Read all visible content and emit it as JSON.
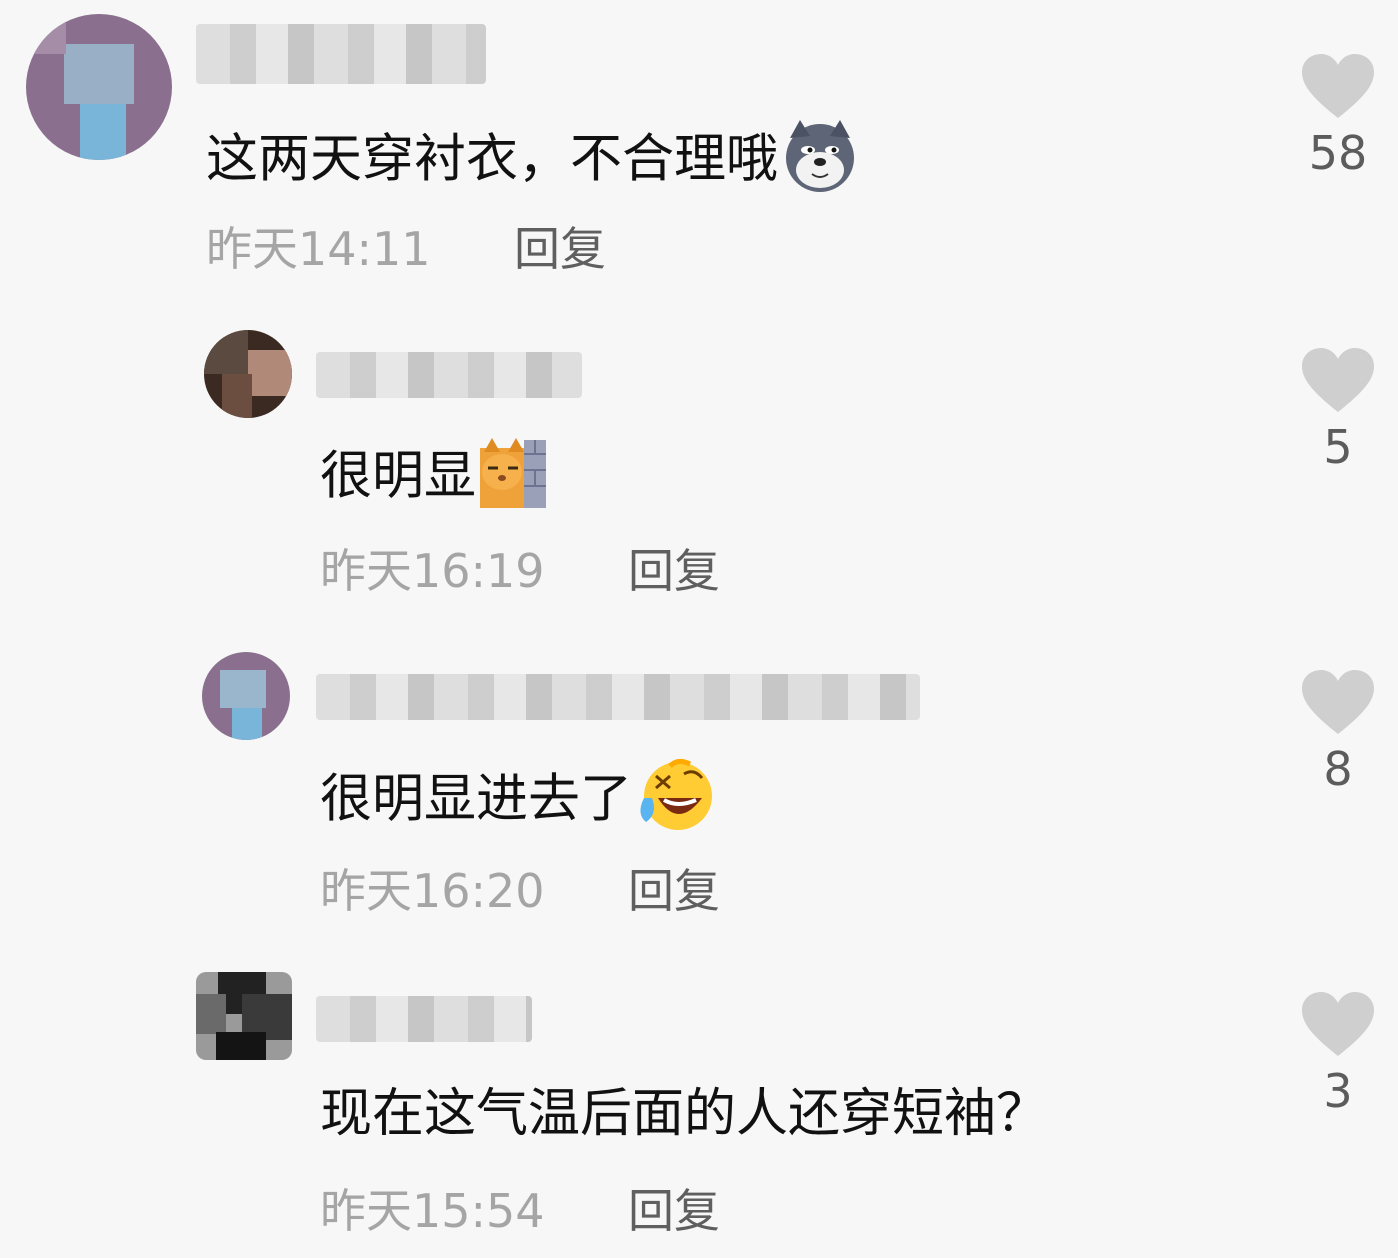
{
  "comments": [
    {
      "text": "这两天穿衬衣，不合理哦",
      "emoji": "husky-doge-emoji",
      "time": "昨天14:11",
      "reply": "回复",
      "likes": "58"
    },
    {
      "text": "很明显",
      "emoji": "cat-behind-wall-emoji",
      "time": "昨天16:19",
      "reply": "回复",
      "likes": "5"
    },
    {
      "text": "很明显进去了",
      "emoji": "laughing-tears-emoji",
      "time": "昨天16:20",
      "reply": "回复",
      "likes": "8"
    },
    {
      "text": "现在这气温后面的人还穿短袖？",
      "emoji": "",
      "time": "昨天15:54",
      "reply": "回复",
      "likes": "3"
    }
  ],
  "colors": {
    "background": "#f7f7f7",
    "heart": "#cfcfcf",
    "time": "#a5a5a5",
    "reply": "#5f5f5f",
    "count": "#5c5c5c"
  },
  "icons": {
    "like": "heart-icon"
  }
}
